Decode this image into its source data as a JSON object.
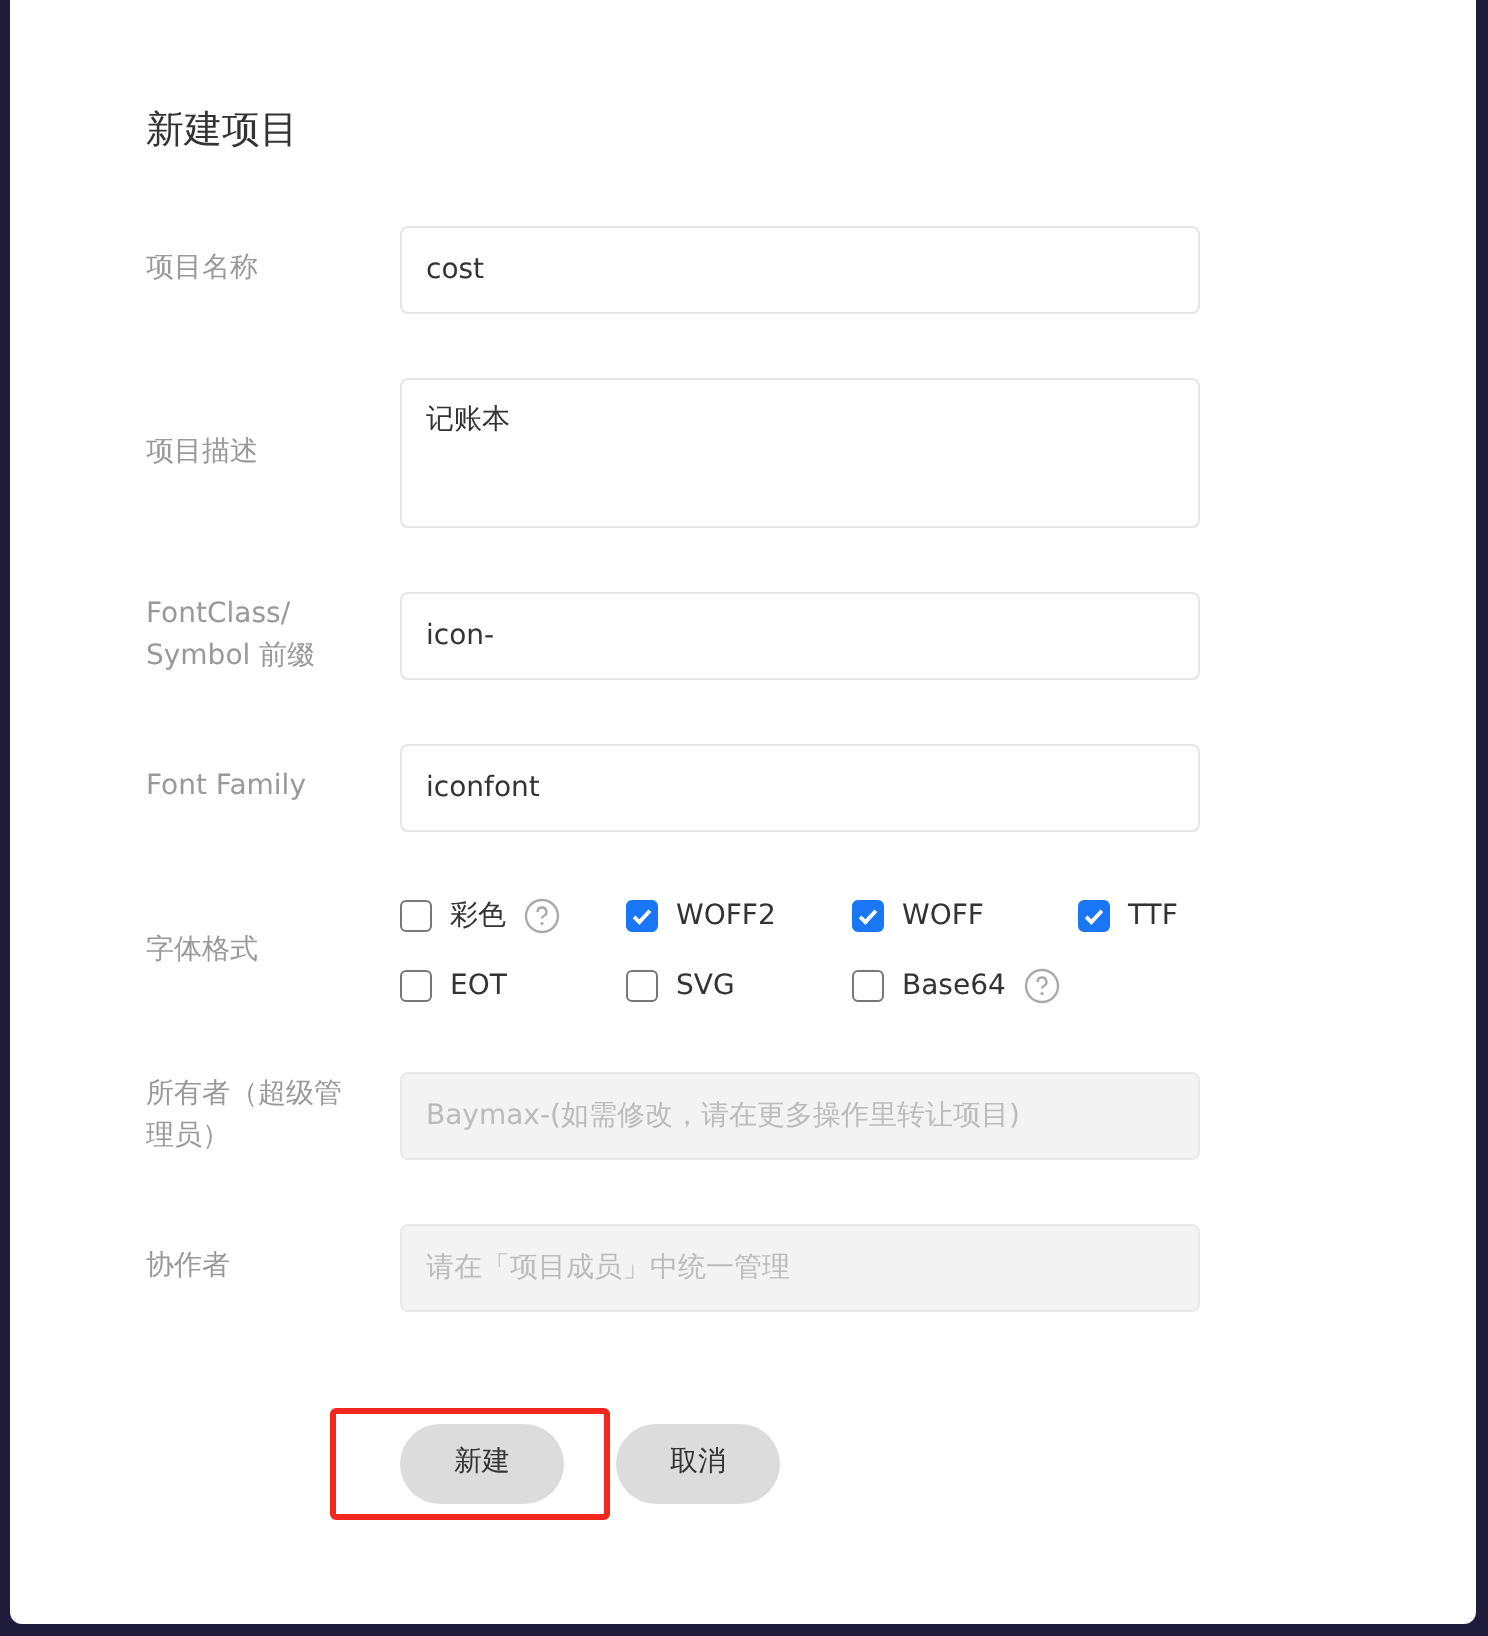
{
  "dialog": {
    "title": "新建项目",
    "fields": [
      {
        "kind": "input",
        "label": "项目名称",
        "value": "cost",
        "disabled": false
      },
      {
        "kind": "textarea",
        "label": "项目描述",
        "value": "记账本",
        "disabled": false
      },
      {
        "kind": "input",
        "label": "FontClass/ Symbol 前缀",
        "value": "icon-",
        "disabled": false
      },
      {
        "kind": "input",
        "label": "Font Family",
        "value": "iconfont",
        "disabled": false
      },
      {
        "kind": "checkboxes",
        "label": "字体格式",
        "options": [
          {
            "label": "彩色",
            "checked": false,
            "help": true
          },
          {
            "label": "WOFF2",
            "checked": true,
            "help": false
          },
          {
            "label": "WOFF",
            "checked": true,
            "help": false
          },
          {
            "label": "TTF",
            "checked": true,
            "help": false
          },
          {
            "label": "EOT",
            "checked": false,
            "help": false
          },
          {
            "label": "SVG",
            "checked": false,
            "help": false
          },
          {
            "label": "Base64",
            "checked": false,
            "help": true
          }
        ]
      },
      {
        "kind": "input",
        "label": "所有者（超级管理员）",
        "placeholder": "Baymax-(如需修改，请在更多操作里转让项目)",
        "disabled": true
      },
      {
        "kind": "input",
        "label": "协作者",
        "placeholder": "请在「项目成员」中统一管理",
        "disabled": true
      }
    ],
    "buttons": [
      {
        "label": "新建",
        "highlighted": true
      },
      {
        "label": "取消",
        "highlighted": false
      }
    ]
  }
}
